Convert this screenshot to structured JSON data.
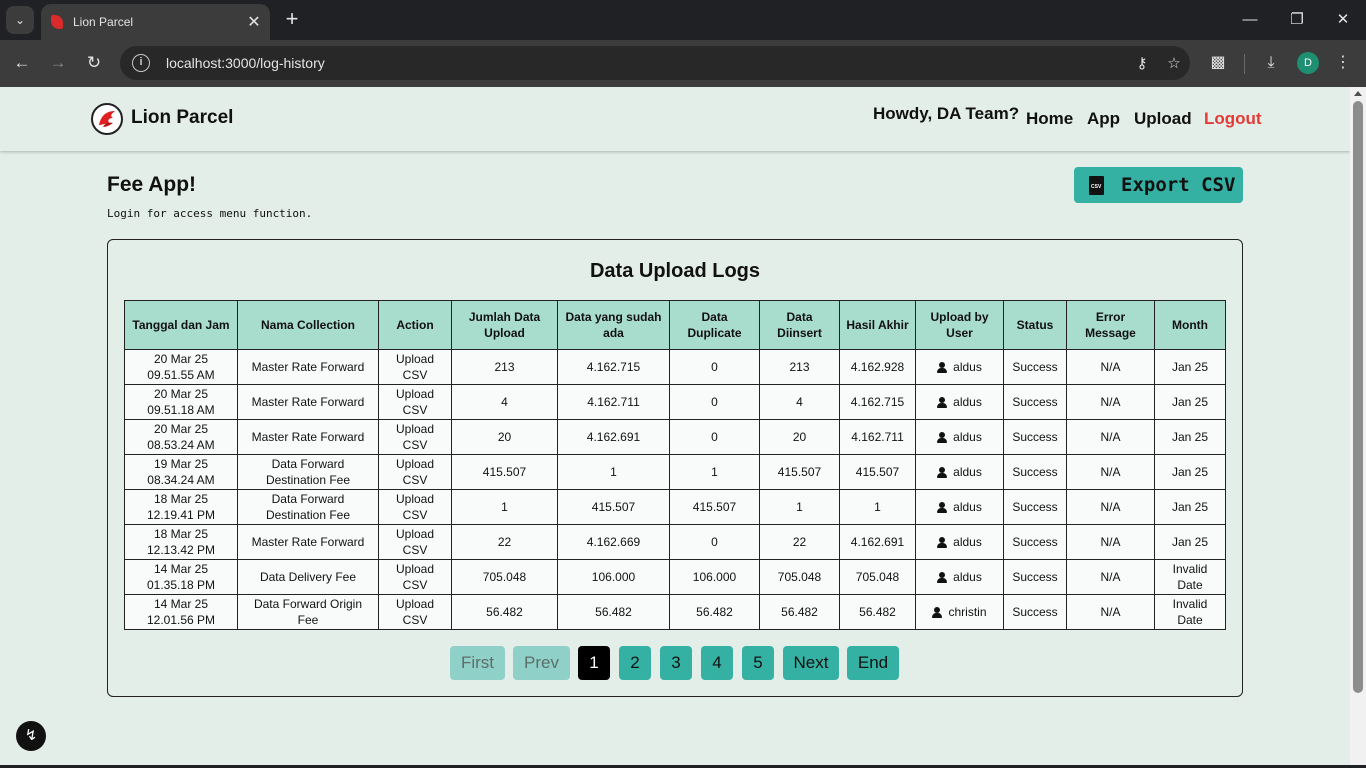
{
  "browser": {
    "tab_title": "Lion Parcel",
    "url": "localhost:3000/log-history",
    "profile_initial": "D"
  },
  "navbar": {
    "brand": "Lion Parcel",
    "greeting": "Howdy, DA Team?",
    "links": [
      "Home",
      "App",
      "Upload"
    ],
    "logout": "Logout"
  },
  "page": {
    "title": "Fee App!",
    "subtitle": "Login for access menu function.",
    "export_label": "Export CSV",
    "export_icon_text": "CSV"
  },
  "table": {
    "title": "Data Upload Logs",
    "headers": [
      "Tanggal dan Jam",
      "Nama Collection",
      "Action",
      "Jumlah Data Upload",
      "Data yang sudah ada",
      "Data Duplicate",
      "Data Diinsert",
      "Hasil Akhir",
      "Upload by User",
      "Status",
      "Error Message",
      "Month"
    ],
    "rows": [
      [
        "20 Mar 25 09.51.55 AM",
        "Master Rate Forward",
        "Upload CSV",
        "213",
        "4.162.715",
        "0",
        "213",
        "4.162.928",
        "aldus",
        "Success",
        "N/A",
        "Jan 25"
      ],
      [
        "20 Mar 25 09.51.18 AM",
        "Master Rate Forward",
        "Upload CSV",
        "4",
        "4.162.711",
        "0",
        "4",
        "4.162.715",
        "aldus",
        "Success",
        "N/A",
        "Jan 25"
      ],
      [
        "20 Mar 25 08.53.24 AM",
        "Master Rate Forward",
        "Upload CSV",
        "20",
        "4.162.691",
        "0",
        "20",
        "4.162.711",
        "aldus",
        "Success",
        "N/A",
        "Jan 25"
      ],
      [
        "19 Mar 25 08.34.24 AM",
        "Data Forward Destination Fee",
        "Upload CSV",
        "415.507",
        "1",
        "1",
        "415.507",
        "415.507",
        "aldus",
        "Success",
        "N/A",
        "Jan 25"
      ],
      [
        "18 Mar 25 12.19.41 PM",
        "Data Forward Destination Fee",
        "Upload CSV",
        "1",
        "415.507",
        "415.507",
        "1",
        "1",
        "aldus",
        "Success",
        "N/A",
        "Jan 25"
      ],
      [
        "18 Mar 25 12.13.42 PM",
        "Master Rate Forward",
        "Upload CSV",
        "22",
        "4.162.669",
        "0",
        "22",
        "4.162.691",
        "aldus",
        "Success",
        "N/A",
        "Jan 25"
      ],
      [
        "14 Mar 25 01.35.18 PM",
        "Data Delivery Fee",
        "Upload CSV",
        "705.048",
        "106.000",
        "106.000",
        "705.048",
        "705.048",
        "aldus",
        "Success",
        "N/A",
        "Invalid Date"
      ],
      [
        "14 Mar 25 12.01.56 PM",
        "Data Forward Origin Fee",
        "Upload CSV",
        "56.482",
        "56.482",
        "56.482",
        "56.482",
        "56.482",
        "christin",
        "Success",
        "N/A",
        "Invalid Date"
      ]
    ]
  },
  "pagination": {
    "first": "First",
    "prev": "Prev",
    "pages": [
      "1",
      "2",
      "3",
      "4",
      "5"
    ],
    "current_page": "1",
    "next": "Next",
    "end": "End"
  }
}
